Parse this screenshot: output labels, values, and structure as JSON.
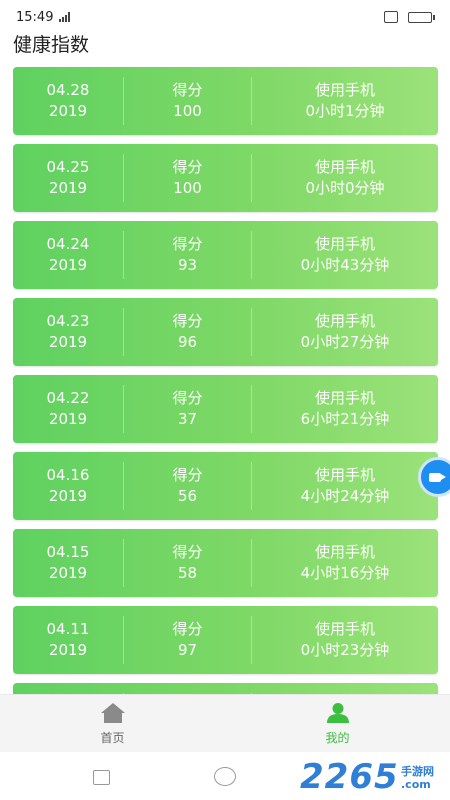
{
  "status_bar": {
    "time": "15:49",
    "signal_text": "·ııl"
  },
  "page": {
    "title": "健康指数"
  },
  "records": [
    {
      "date": "04.28",
      "year": "2019",
      "score_label": "得分",
      "score": "100",
      "usage_label": "使用手机",
      "usage": "0小时1分钟"
    },
    {
      "date": "04.25",
      "year": "2019",
      "score_label": "得分",
      "score": "100",
      "usage_label": "使用手机",
      "usage": "0小时0分钟"
    },
    {
      "date": "04.24",
      "year": "2019",
      "score_label": "得分",
      "score": "93",
      "usage_label": "使用手机",
      "usage": "0小时43分钟"
    },
    {
      "date": "04.23",
      "year": "2019",
      "score_label": "得分",
      "score": "96",
      "usage_label": "使用手机",
      "usage": "0小时27分钟"
    },
    {
      "date": "04.22",
      "year": "2019",
      "score_label": "得分",
      "score": "37",
      "usage_label": "使用手机",
      "usage": "6小时21分钟"
    },
    {
      "date": "04.16",
      "year": "2019",
      "score_label": "得分",
      "score": "56",
      "usage_label": "使用手机",
      "usage": "4小时24分钟"
    },
    {
      "date": "04.15",
      "year": "2019",
      "score_label": "得分",
      "score": "58",
      "usage_label": "使用手机",
      "usage": "4小时16分钟"
    },
    {
      "date": "04.11",
      "year": "2019",
      "score_label": "得分",
      "score": "97",
      "usage_label": "使用手机",
      "usage": "0小时23分钟"
    },
    {
      "date": "",
      "year": "",
      "score_label": "",
      "score": "",
      "usage_label": "",
      "usage": ""
    }
  ],
  "bottom_nav": {
    "home_label": "首页",
    "mine_label": "我的",
    "active_color": "#3cbf3f",
    "inactive_color": "#666666"
  },
  "watermark": {
    "main": "2265",
    "suffix": ".com",
    "small": "手游网"
  },
  "colors": {
    "card_start": "#5fd160",
    "card_end": "#9be27a",
    "float_button": "#1f8ef1"
  }
}
